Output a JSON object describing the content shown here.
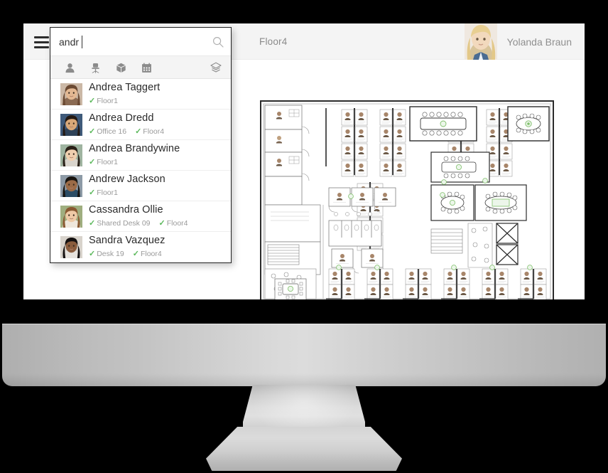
{
  "device": {
    "type": "desktop-monitor"
  },
  "app_bar": {
    "menu_icon": "hamburger-icon",
    "floor_label": "Floor4",
    "user": {
      "name": "Yolanda Braun",
      "avatar_icon": "user-avatar-photo"
    }
  },
  "search": {
    "value": "andr",
    "placeholder": "Search",
    "search_icon": "search-icon",
    "filters": [
      {
        "id": "people",
        "icon": "person-icon",
        "label": "People"
      },
      {
        "id": "desks",
        "icon": "chair-icon",
        "label": "Desks"
      },
      {
        "id": "assets",
        "icon": "box-icon",
        "label": "Assets"
      },
      {
        "id": "bookings",
        "icon": "calendar-icon",
        "label": "Bookings"
      }
    ],
    "layers": {
      "id": "layers",
      "icon": "layers-icon",
      "label": "Layers"
    },
    "results": [
      {
        "name": "Andrea Taggert",
        "tags": [
          "Floor1"
        ]
      },
      {
        "name": "Andrea Dredd",
        "tags": [
          "Office 16",
          "Floor4"
        ]
      },
      {
        "name": "Andrea Brandywine",
        "tags": [
          "Floor1"
        ]
      },
      {
        "name": "Andrew Jackson",
        "tags": [
          "Floor1"
        ]
      },
      {
        "name": "Cassandra Ollie",
        "tags": [
          "Shared Desk 09",
          "Floor4"
        ]
      },
      {
        "name": "Sandra Vazquez",
        "tags": [
          "Desk 19",
          "Floor4"
        ]
      }
    ]
  },
  "map": {
    "name": "floorplan-Floor4",
    "description": "Architectural office floor plan with desks, offices, meeting rooms, stairs and elevators"
  },
  "colors": {
    "tick_green": "#5bb85b",
    "header_bg": "#f4f4f4",
    "panel_border": "#222222",
    "text_primary": "#2a2a2a",
    "text_muted": "#9a9a9a"
  }
}
